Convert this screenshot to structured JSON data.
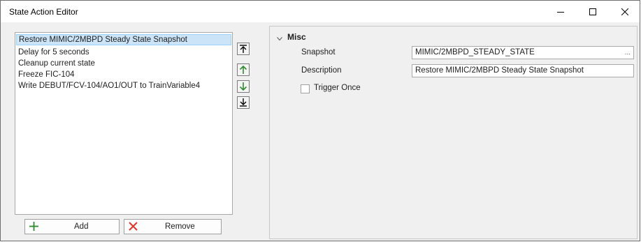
{
  "window": {
    "title": "State Action Editor"
  },
  "actions_list": {
    "items": [
      "Restore MIMIC/2MBPD Steady State Snapshot",
      "Delay for 5 seconds",
      "Cleanup current state",
      "Freeze FIC-104",
      "Write DEBUT/FCV-104/AO1/OUT to TrainVariable4"
    ],
    "selected_index": 0
  },
  "buttons": {
    "add_label": "Add",
    "remove_label": "Remove"
  },
  "icons": {
    "move_top": "move-to-top-icon",
    "move_up": "move-up-icon",
    "move_down": "move-down-icon",
    "move_bottom": "move-to-bottom-icon",
    "add": "plus-icon",
    "remove": "x-icon",
    "add_color": "#2e8b2e",
    "remove_color": "#e0342c",
    "arrow_up_color": "#2e8b2e",
    "arrow_down_color": "#2e8b2e"
  },
  "properties": {
    "category": "Misc",
    "snapshot_label": "Snapshot",
    "snapshot_value": "MIMIC/2MBPD_STEADY_STATE",
    "snapshot_button": "...",
    "description_label": "Description",
    "description_value": "Restore MIMIC/2MBPD Steady State Snapshot",
    "trigger_once_label": "Trigger Once",
    "trigger_once_checked": false
  },
  "colors": {
    "selection_bg": "#cce4f7",
    "selection_border": "#99d1ff",
    "panel_bg": "#f0f0f0"
  }
}
